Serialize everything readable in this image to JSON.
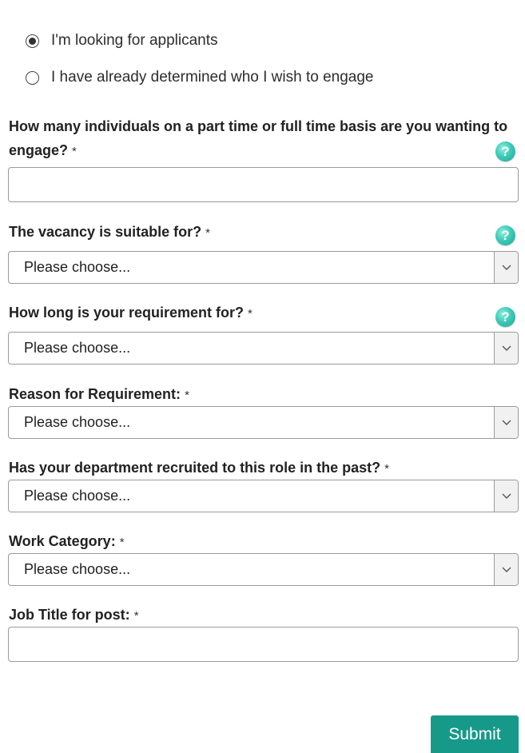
{
  "radio_options": [
    {
      "label": "I'm looking for applicants",
      "selected": true
    },
    {
      "label": "I have already determined who I wish to engage",
      "selected": false
    }
  ],
  "required_marker": "*",
  "help_icon_glyph": "?",
  "questions": {
    "individuals": {
      "label": "How many individuals on a part time or full time basis are you wanting to engage?",
      "value": ""
    },
    "suitable_for": {
      "label": "The vacancy is suitable for?",
      "value": "Please choose..."
    },
    "duration": {
      "label": "How long is your requirement for?",
      "value": "Please choose..."
    },
    "reason": {
      "label": "Reason for Requirement:",
      "value": "Please choose..."
    },
    "recruited_before": {
      "label": "Has your department recruited to this role in the past?",
      "value": "Please choose..."
    },
    "work_category": {
      "label": "Work Category:",
      "value": "Please choose..."
    },
    "job_title": {
      "label": "Job Title for post:",
      "value": ""
    }
  },
  "submit_label": "Submit",
  "colors": {
    "accent": "#17998a",
    "help_icon": "#3fc9b7"
  }
}
